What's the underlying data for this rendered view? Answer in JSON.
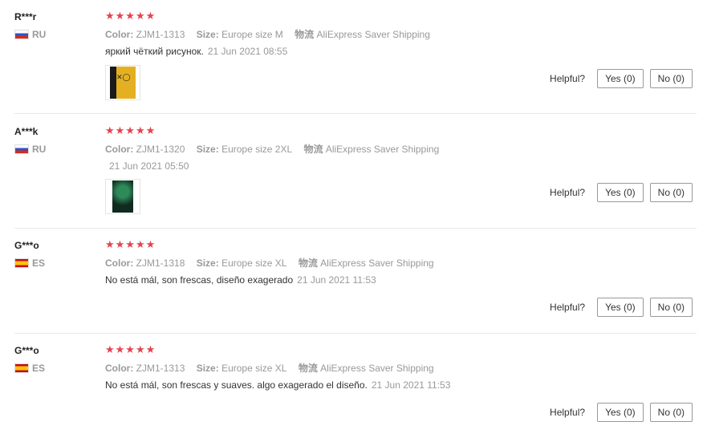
{
  "helpful_label": "Helpful?",
  "color_label": "Color:",
  "size_label": "Size:",
  "logistics_label": "物流",
  "star_color": "#e5424d",
  "reviews": [
    {
      "user": "R***r",
      "country": "RU",
      "flag_icon": "flag-russia-icon",
      "stars": "★★★★★",
      "color": "ZJM1-1313",
      "size": "Europe size M",
      "shipping": "AliExpress Saver Shipping",
      "comment": "яркий чёткий рисунок.",
      "date": "21 Jun 2021 08:55",
      "yes": "Yes (0)",
      "no": "No (0)"
    },
    {
      "user": "A***k",
      "country": "RU",
      "flag_icon": "flag-russia-icon",
      "stars": "★★★★★",
      "color": "ZJM1-1320",
      "size": "Europe size 2XL",
      "shipping": "AliExpress Saver Shipping",
      "comment": "",
      "date": "21 Jun 2021 05:50",
      "yes": "Yes (0)",
      "no": "No (0)"
    },
    {
      "user": "G***o",
      "country": "ES",
      "flag_icon": "flag-spain-icon",
      "stars": "★★★★★",
      "color": "ZJM1-1318",
      "size": "Europe size XL",
      "shipping": "AliExpress Saver Shipping",
      "comment": "No está mál, son frescas, diseño exagerado",
      "date": "21 Jun 2021 11:53",
      "yes": "Yes (0)",
      "no": "No (0)"
    },
    {
      "user": "G***o",
      "country": "ES",
      "flag_icon": "flag-spain-icon",
      "stars": "★★★★★",
      "color": "ZJM1-1313",
      "size": "Europe size XL",
      "shipping": "AliExpress Saver Shipping",
      "comment": "No está mál, son frescas y suaves. algo exagerado el diseño.",
      "date": "21 Jun 2021 11:53",
      "yes": "Yes (0)",
      "no": "No (0)"
    }
  ]
}
